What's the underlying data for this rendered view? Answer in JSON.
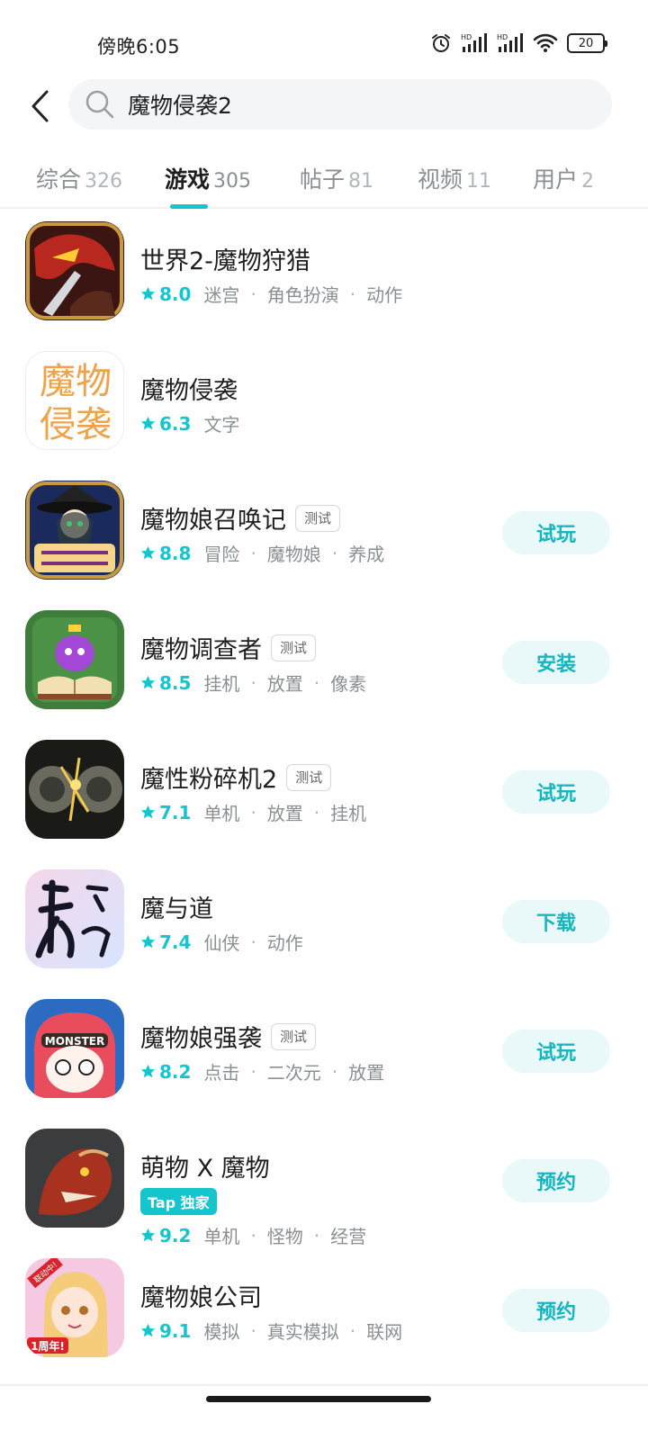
{
  "status_bar": {
    "time": "傍晚6:05",
    "battery": "20",
    "signal_label_1": "HD",
    "signal_label_2": "HD"
  },
  "search": {
    "query": "魔物侵袭2",
    "placeholder": ""
  },
  "tabs": [
    {
      "label": "综合",
      "count": "326",
      "active": false
    },
    {
      "label": "游戏",
      "count": "305",
      "active": true
    },
    {
      "label": "帖子",
      "count": "81",
      "active": false
    },
    {
      "label": "视频",
      "count": "11",
      "active": false
    },
    {
      "label": "用户",
      "count": "2",
      "active": false
    }
  ],
  "games": [
    {
      "name": "世界2-魔物狩猎",
      "rating": "8.0",
      "tags": [
        "迷宫",
        "角色扮演",
        "动作"
      ],
      "badge": "",
      "action": "",
      "icon": "dragon-warrior-icon"
    },
    {
      "name": "魔物侵袭",
      "rating": "6.3",
      "tags": [
        "文字"
      ],
      "badge": "",
      "action": "",
      "icon": "text-logo-icon",
      "icon_text_1": "魔物",
      "icon_text_2": "侵袭"
    },
    {
      "name": "魔物娘召唤记",
      "rating": "8.8",
      "tags": [
        "冒险",
        "魔物娘",
        "养成"
      ],
      "badge": "测试",
      "action": "试玩",
      "icon": "witch-girl-icon"
    },
    {
      "name": "魔物调查者",
      "rating": "8.5",
      "tags": [
        "挂机",
        "放置",
        "像素"
      ],
      "badge": "测试",
      "action": "安装",
      "icon": "pixel-slime-book-icon"
    },
    {
      "name": "魔性粉碎机2",
      "rating": "7.1",
      "tags": [
        "单机",
        "放置",
        "挂机"
      ],
      "badge": "测试",
      "action": "试玩",
      "icon": "grinder-icon"
    },
    {
      "name": "魔与道",
      "rating": "7.4",
      "tags": [
        "仙侠",
        "动作"
      ],
      "badge": "",
      "action": "下载",
      "icon": "calligraphy-icon"
    },
    {
      "name": "魔物娘强袭",
      "rating": "8.2",
      "tags": [
        "点击",
        "二次元",
        "放置"
      ],
      "badge": "测试",
      "action": "试玩",
      "icon": "monster-girl-icon",
      "icon_text": "MONSTER"
    },
    {
      "name": "萌物 X 魔物",
      "rating": "9.2",
      "tags": [
        "单机",
        "怪物",
        "经营"
      ],
      "badge": "",
      "exclusive": "Tap 独家",
      "action": "预约",
      "icon": "red-dragon-icon"
    },
    {
      "name": "魔物娘公司",
      "rating": "9.1",
      "tags": [
        "模拟",
        "真实模拟",
        "联网"
      ],
      "badge": "",
      "action": "预约",
      "icon": "anime-girl-icon",
      "icon_text_1": "联动中!",
      "icon_text_2": "1周年!"
    }
  ],
  "colors": {
    "accent": "#15c5ce",
    "action_bg": "#e9f8f9",
    "text_primary": "#1f1f1f",
    "text_secondary": "#8b8f93"
  }
}
